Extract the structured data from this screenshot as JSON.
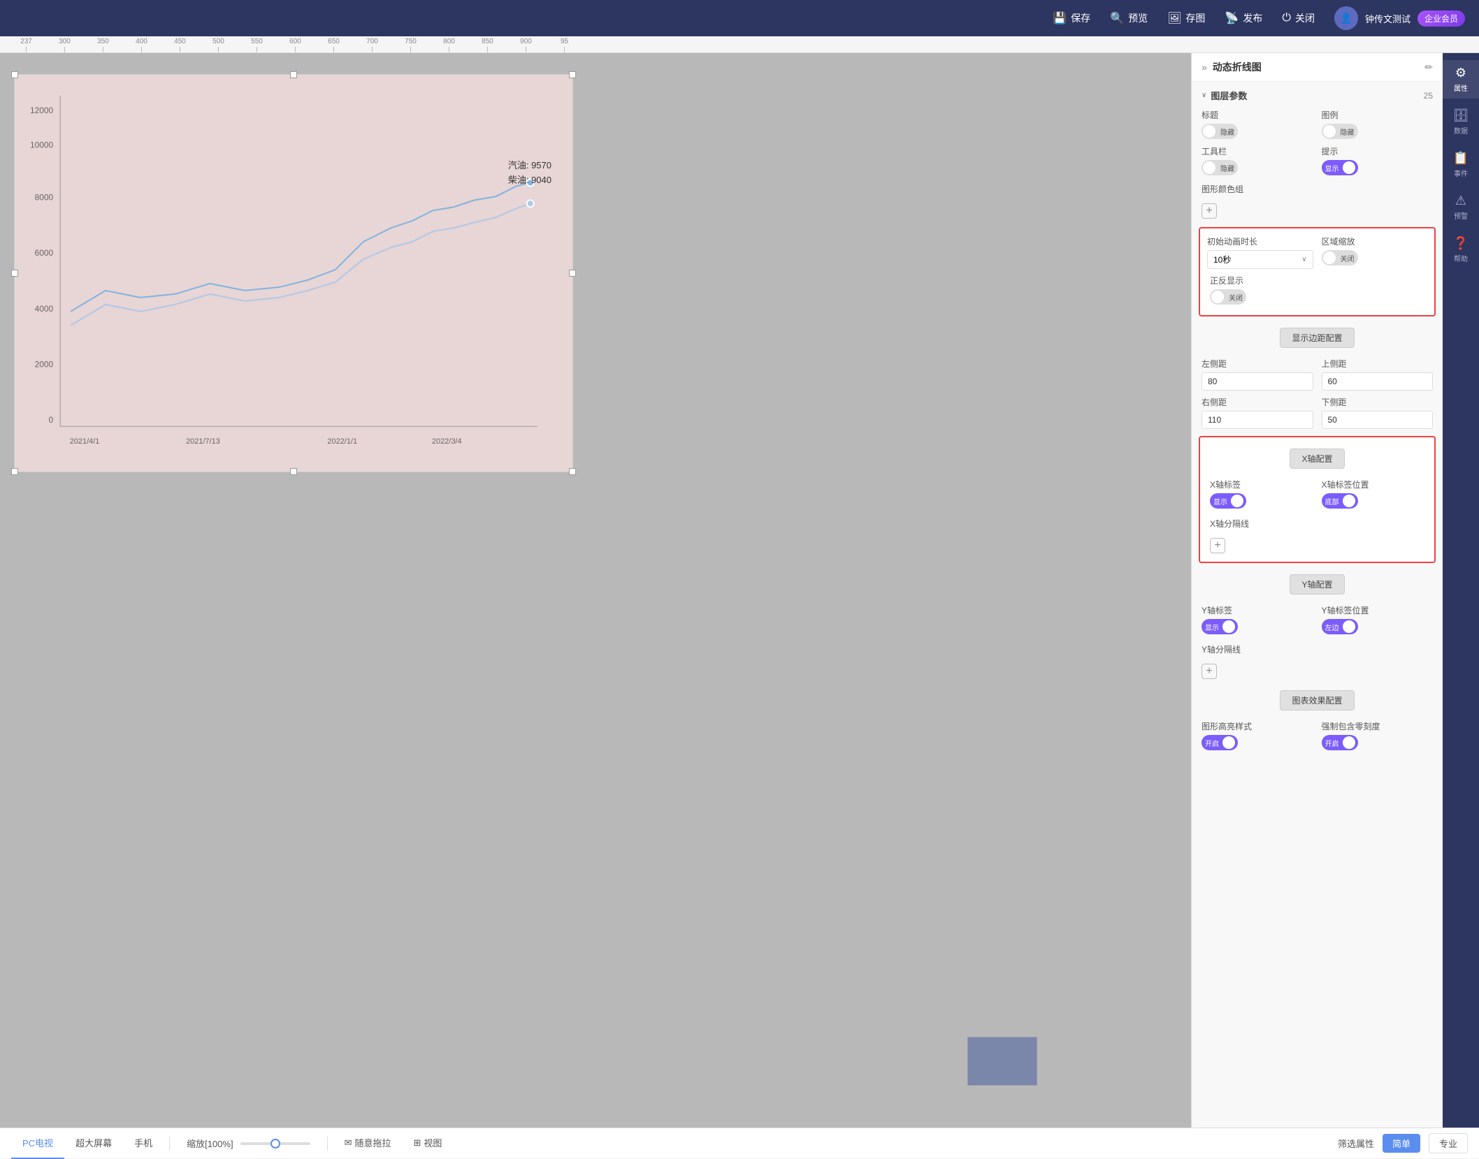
{
  "topbar": {
    "save_label": "保存",
    "preview_label": "预览",
    "store_label": "存图",
    "publish_label": "发布",
    "close_label": "关闭",
    "username": "钟传文测试",
    "vip_label": "企业会员"
  },
  "ruler": {
    "marks": [
      "237",
      "300",
      "350",
      "400",
      "450",
      "500",
      "550",
      "600",
      "650",
      "700",
      "750",
      "800",
      "850",
      "900",
      "95"
    ]
  },
  "chart": {
    "tooltip_line1": "汽油: 9570",
    "tooltip_line2": "柴油: 9040",
    "y_labels": [
      "12000",
      "10000",
      "8000",
      "6000",
      "4000",
      "2000",
      "0"
    ],
    "x_labels": [
      "2021/4/1",
      "2021/7/13",
      "2022/1/1",
      "2022/3/4"
    ]
  },
  "panel": {
    "title": "动态折线图",
    "section_params_label": "图层参数",
    "section_count": "25",
    "title_label": "标题",
    "title_toggle": "隐藏",
    "title_toggle_state": "off",
    "legend_label": "图例",
    "legend_toggle": "隐藏",
    "legend_toggle_state": "off",
    "toolbar_label": "工具栏",
    "toolbar_toggle": "隐藏",
    "toolbar_toggle_state": "off",
    "hint_label": "提示",
    "hint_toggle": "显示",
    "hint_toggle_state": "on-purple",
    "color_group_label": "图形颜色组",
    "add_color_label": "+",
    "animation_label": "初始动画时长",
    "animation_value": "10秒",
    "zoom_label": "区域缩放",
    "zoom_toggle": "关闭",
    "zoom_toggle_state": "off",
    "forward_label": "正反显示",
    "forward_toggle": "关闭",
    "forward_toggle_state": "off",
    "margin_config_label": "显示边距配置",
    "left_margin_label": "左侧距",
    "left_margin_value": "80",
    "top_margin_label": "上侧距",
    "top_margin_value": "60",
    "right_margin_label": "右侧距",
    "right_margin_value": "110",
    "bottom_margin_label": "下侧距",
    "bottom_margin_value": "50",
    "xaxis_config_label": "X轴配置",
    "x_label_label": "X轴标签",
    "x_label_toggle": "显示",
    "x_label_toggle_state": "on-purple",
    "x_label_pos_label": "X轴标签位置",
    "x_label_pos_toggle": "底部",
    "x_label_pos_toggle_state": "on-purple",
    "x_split_label": "X轴分隔线",
    "x_split_add": "+",
    "yaxis_config_label": "Y轴配置",
    "y_label_label": "Y轴标签",
    "y_label_toggle": "显示",
    "y_label_toggle_state": "on-purple",
    "y_label_pos_label": "Y轴标签位置",
    "y_label_pos_toggle": "左边",
    "y_label_pos_toggle_state": "on-purple",
    "y_split_label": "Y轴分隔线",
    "y_split_add": "+",
    "effect_config_label": "图表效果配置",
    "highlight_label": "图形高亮样式",
    "highlight_toggle": "开启",
    "highlight_toggle_state": "on-purple",
    "zero_label": "强制包含零刻度",
    "zero_toggle": "开启",
    "zero_toggle_state": "on-purple"
  },
  "sidebar_icons": [
    {
      "name": "属性",
      "icon": "⚙"
    },
    {
      "name": "数据",
      "icon": "🗄"
    },
    {
      "name": "事件",
      "icon": "📋"
    },
    {
      "name": "预警",
      "icon": "⚠"
    },
    {
      "name": "帮助",
      "icon": "❓"
    }
  ],
  "bottom": {
    "device_pc": "PC电视",
    "device_xl": "超大屏幕",
    "device_mobile": "手机",
    "zoom_label": "缩放[100%]",
    "drag_label": "随意拖拉",
    "view_label": "视图",
    "filter_label": "筛选属性",
    "simple_label": "简单",
    "pro_label": "专业"
  }
}
